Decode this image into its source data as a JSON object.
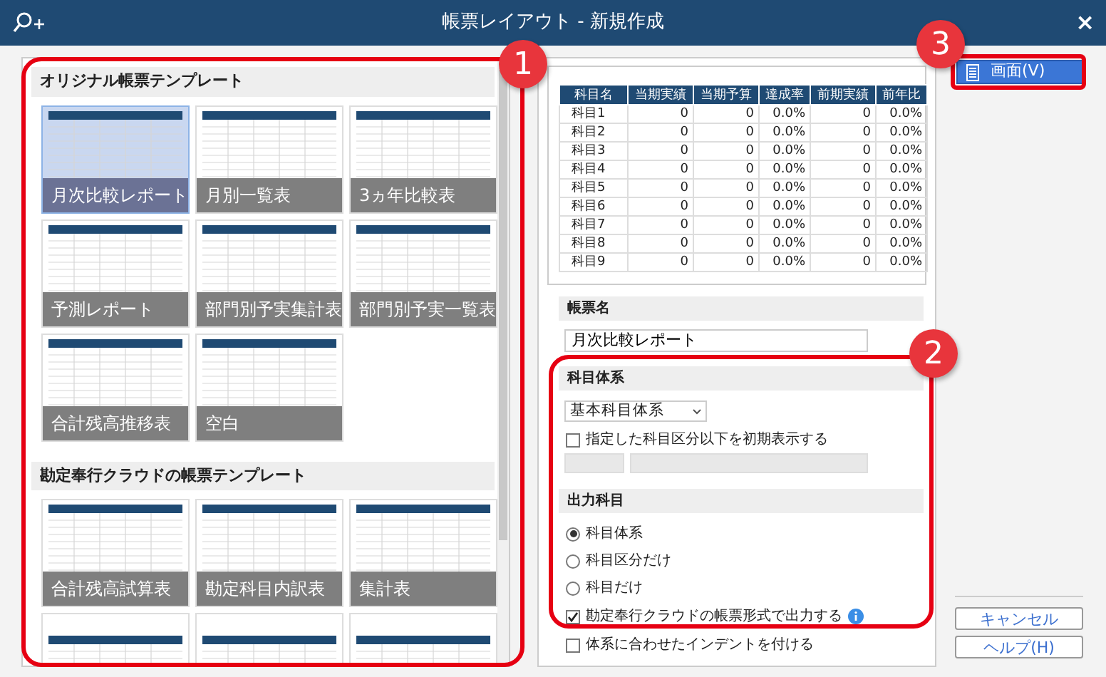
{
  "window": {
    "title": "帳票レイアウト - 新規作成",
    "close": "×"
  },
  "template_sections": [
    {
      "title": "オリジナル帳票テンプレート",
      "tiles": [
        {
          "label": "月次比較レポート",
          "selected": true
        },
        {
          "label": "月別一覧表",
          "selected": false
        },
        {
          "label": "3ヵ年比較表",
          "selected": false
        },
        {
          "label": "予測レポート",
          "selected": false
        },
        {
          "label": "部門別予実集計表",
          "selected": false
        },
        {
          "label": "部門別予実一覧表",
          "selected": false
        },
        {
          "label": "合計残高推移表",
          "selected": false
        },
        {
          "label": "空白",
          "selected": false
        }
      ]
    },
    {
      "title": "勘定奉行クラウドの帳票テンプレート",
      "tiles": [
        {
          "label": "合計残高試算表",
          "selected": false
        },
        {
          "label": "勘定科目内訳表",
          "selected": false
        },
        {
          "label": "集計表",
          "selected": false
        },
        {
          "selected": false
        },
        {
          "selected": false
        },
        {
          "selected": false
        }
      ]
    }
  ],
  "preview_table": {
    "columns": [
      "科目名",
      "当期実績",
      "当期予算",
      "達成率",
      "前期実績",
      "前年比"
    ],
    "rows": [
      [
        "科目1",
        "0",
        "0",
        "0.0%",
        "0",
        "0.0%"
      ],
      [
        "科目2",
        "0",
        "0",
        "0.0%",
        "0",
        "0.0%"
      ],
      [
        "科目3",
        "0",
        "0",
        "0.0%",
        "0",
        "0.0%"
      ],
      [
        "科目4",
        "0",
        "0",
        "0.0%",
        "0",
        "0.0%"
      ],
      [
        "科目5",
        "0",
        "0",
        "0.0%",
        "0",
        "0.0%"
      ],
      [
        "科目6",
        "0",
        "0",
        "0.0%",
        "0",
        "0.0%"
      ],
      [
        "科目7",
        "0",
        "0",
        "0.0%",
        "0",
        "0.0%"
      ],
      [
        "科目8",
        "0",
        "0",
        "0.0%",
        "0",
        "0.0%"
      ],
      [
        "科目9",
        "0",
        "0",
        "0.0%",
        "0",
        "0.0%"
      ]
    ]
  },
  "report_name": {
    "label": "帳票名",
    "value": "月次比較レポート"
  },
  "account_system": {
    "label": "科目体系",
    "dropdown": "基本科目体系",
    "initial_display": {
      "label": "指定した科目区分以下を初期表示する",
      "checked": false
    }
  },
  "output_accounts": {
    "label": "出力科目",
    "options": [
      {
        "label": "科目体系",
        "selected": true
      },
      {
        "label": "科目区分だけ",
        "selected": false
      },
      {
        "label": "科目だけ",
        "selected": false
      }
    ],
    "checks": [
      {
        "label": "勘定奉行クラウドの帳票形式で出力する",
        "checked": true,
        "info": true
      },
      {
        "label": "体系に合わせたインデントを付ける",
        "checked": false
      }
    ]
  },
  "buttons": {
    "view": "画面(V)",
    "cancel": "キャンセル",
    "help": "ヘルプ(H)"
  },
  "callouts": [
    {
      "number": "1"
    },
    {
      "number": "2"
    },
    {
      "number": "3"
    }
  ]
}
